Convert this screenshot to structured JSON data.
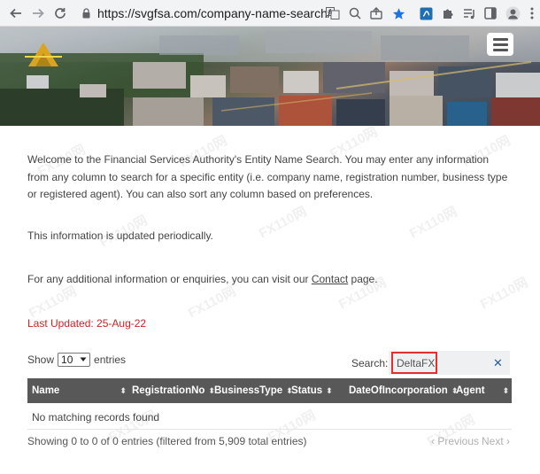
{
  "browser": {
    "url": "https://svgfsa.com/company-name-search/",
    "icons": [
      "back-arrow-icon",
      "forward-arrow-icon",
      "reload-icon",
      "lock-icon",
      "translate-icon",
      "zoom-icon",
      "share-icon",
      "bookmark-star-icon",
      "extension-icon",
      "puzzle-icon",
      "media-queue-icon",
      "side-panel-icon",
      "profile-icon",
      "more-menu-icon"
    ],
    "star_color": "#1a73e8"
  },
  "intro": {
    "welcome": "Welcome to the Financial Services Authority's Entity Name Search. You may enter any information from any column to search for a specific entity (i.e. company name, registration number, business type or registered agent). You can also sort any column based on preferences.",
    "periodic": "This information is updated periodically.",
    "contact_before": "For any additional information or enquiries, you can visit our ",
    "contact_link": "Contact",
    "contact_after": " page."
  },
  "last_updated": {
    "text": "Last Updated:  25-Aug-22",
    "color": "#cc2222"
  },
  "table_controls": {
    "show_label": "Show",
    "entries_value": "10",
    "entries_label": "entries",
    "search_label": "Search:",
    "search_value": "DeltaFX",
    "clear_symbol": "✕"
  },
  "table": {
    "columns": [
      "Name",
      "RegistrationNo",
      "BusinessType",
      "Status",
      "DateOfIncorporation",
      "Agent"
    ],
    "empty_message": "No matching records found",
    "header_color": "#585858"
  },
  "footer": {
    "info": "Showing 0 to 0 of 0 entries (filtered from 5,909 total entries)",
    "previous": "Previous",
    "next": "Next"
  },
  "watermark_text": "FX110网"
}
